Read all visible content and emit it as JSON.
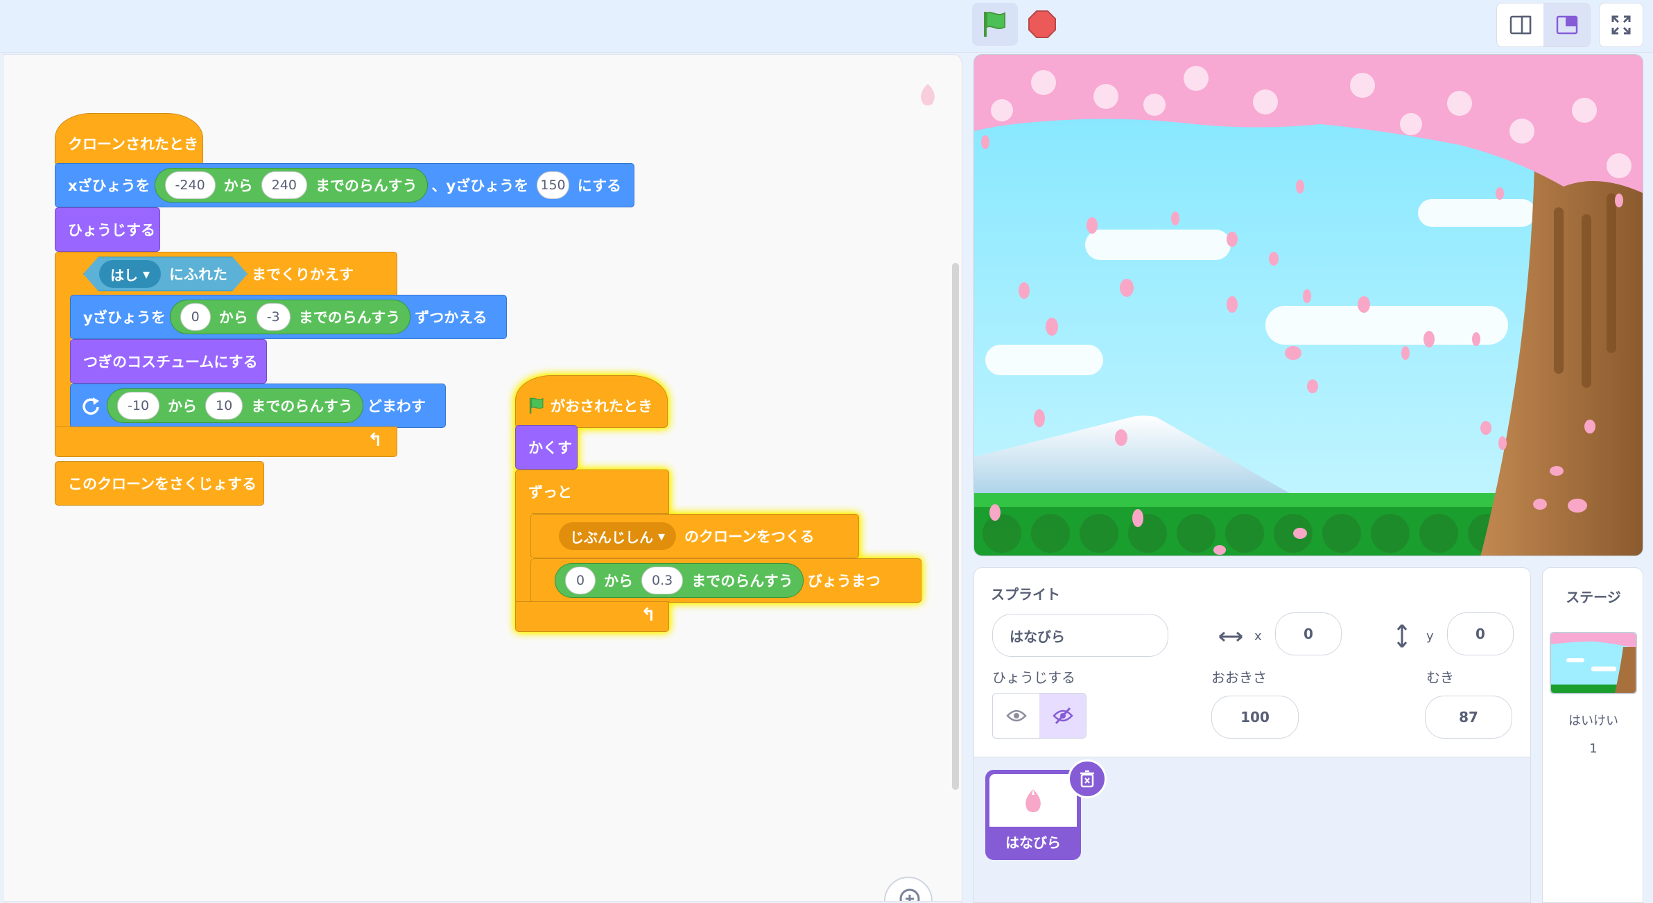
{
  "toolbar": {
    "flag_icon": "green-flag",
    "stop_icon": "stop-octagon"
  },
  "scripts": {
    "when_clone": "クローンされたとき",
    "set_xy": {
      "pre": "xざひょうを",
      "from": "-240",
      "mid": "から",
      "to": "240",
      "post": "までのらんすう",
      "mid2": "、yざひょうを",
      "y": "150",
      "end": "にする"
    },
    "show": "ひょうじする",
    "repeat_until": {
      "sensor": "はし",
      "touching": "にふれた",
      "tail": "までくりかえす"
    },
    "change_y": {
      "pre": "yざひょうを",
      "from": "0",
      "mid": "から",
      "to": "-3",
      "post": "までのらんすう",
      "end": "ずつかえる"
    },
    "next_costume": "つぎのコスチュームにする",
    "turn": {
      "from": "-10",
      "mid": "から",
      "to": "10",
      "post": "までのらんすう",
      "end": "どまわす"
    },
    "delete_clone": "このクローンをさくじょする",
    "when_flag": "がおされたとき",
    "hide": "かくす",
    "forever": "ずっと",
    "create_clone": {
      "target": "じぶんじしん",
      "end": "のクローンをつくる"
    },
    "wait": {
      "from": "0",
      "mid": "から",
      "to": "0.3",
      "post": "までのらんすう",
      "end": "びょうまつ"
    }
  },
  "sprite_info": {
    "title": "スプライト",
    "name": "はなびら",
    "x_label": "x",
    "x": "0",
    "y_label": "y",
    "y": "0",
    "show_label": "ひょうじする",
    "size_label": "おおきさ",
    "size": "100",
    "direction_label": "むき",
    "direction": "87"
  },
  "sprites": [
    {
      "name": "はなびら",
      "selected": true
    }
  ],
  "stage_panel": {
    "title": "ステージ",
    "backdrop_name": "はいけい",
    "backdrop_count": "1"
  },
  "colors": {
    "events": "#ffab19",
    "motion": "#4c97ff",
    "looks": "#9966ff",
    "operators": "#59c059",
    "sensing": "#5cb1d6",
    "accent": "#855cd6"
  }
}
